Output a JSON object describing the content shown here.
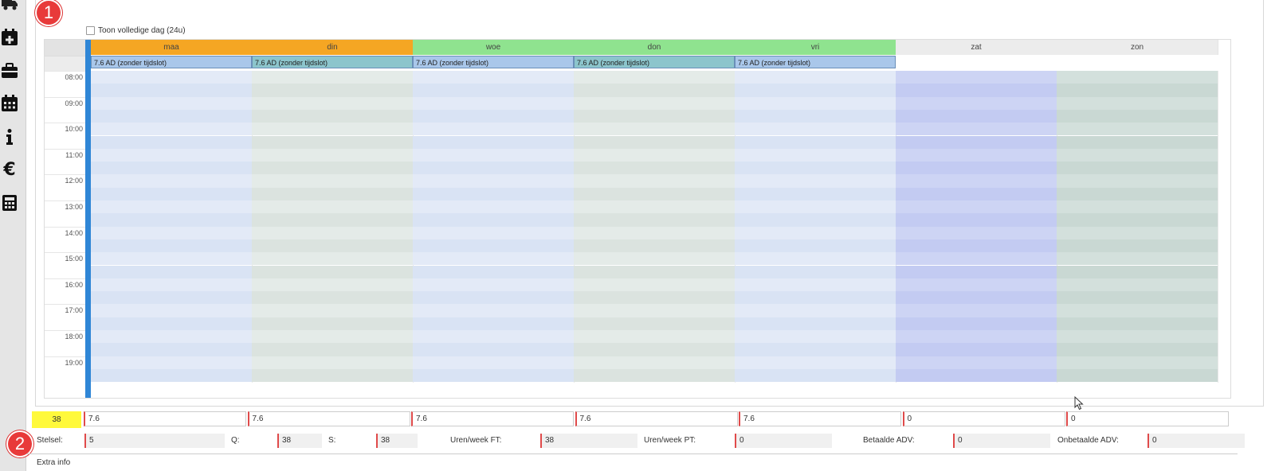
{
  "sidebar": {
    "icons": [
      "truck-icon",
      "calendar-plus-icon",
      "briefcase-icon",
      "calendar-icon",
      "info-icon",
      "euro-icon",
      "calculator-icon"
    ]
  },
  "badges": {
    "one": "1",
    "two": "2"
  },
  "calendar": {
    "toggle_label": "Toon volledige dag (24u)",
    "days": [
      {
        "label": "maa",
        "head_color": "#f5a623",
        "allday": "7.6 AD (zonder tijdslot)"
      },
      {
        "label": "din",
        "head_color": "#f5a623",
        "allday": "7.6 AD (zonder tijdslot)"
      },
      {
        "label": "woe",
        "head_color": "#8fe38f",
        "allday": "7.6 AD (zonder tijdslot)"
      },
      {
        "label": "don",
        "head_color": "#8fe38f",
        "allday": "7.6 AD (zonder tijdslot)"
      },
      {
        "label": "vri",
        "head_color": "#8fe38f",
        "allday": "7.6 AD (zonder tijdslot)"
      },
      {
        "label": "zat",
        "head_color": "#ececec",
        "allday": ""
      },
      {
        "label": "zon",
        "head_color": "#ececec",
        "allday": ""
      }
    ],
    "times": [
      "08:00",
      "09:00",
      "10:00",
      "11:00",
      "12:00",
      "13:00",
      "14:00",
      "15:00",
      "16:00",
      "17:00",
      "18:00",
      "19:00"
    ]
  },
  "totals": {
    "week_total": "38",
    "day_values": [
      "7.6",
      "7.6",
      "7.6",
      "7.6",
      "7.6",
      "0",
      "0"
    ]
  },
  "footer": {
    "stelsel_label": "Stelsel:",
    "stelsel_value": "5",
    "q_label": "Q:",
    "q_value": "38",
    "s_label": "S:",
    "s_value": "38",
    "ft_label": "Uren/week FT:",
    "ft_value": "38",
    "pt_label": "Uren/week PT:",
    "pt_value": "0",
    "badv_label": "Betaalde ADV:",
    "badv_value": "0",
    "oadv_label": "Onbetaalde ADV:",
    "oadv_value": "0",
    "extra_label": "Extra info"
  },
  "colors": {
    "accent_blue": "#2f86d6",
    "badge_red": "#e83a3a",
    "highlight_yellow": "#fff93b"
  }
}
